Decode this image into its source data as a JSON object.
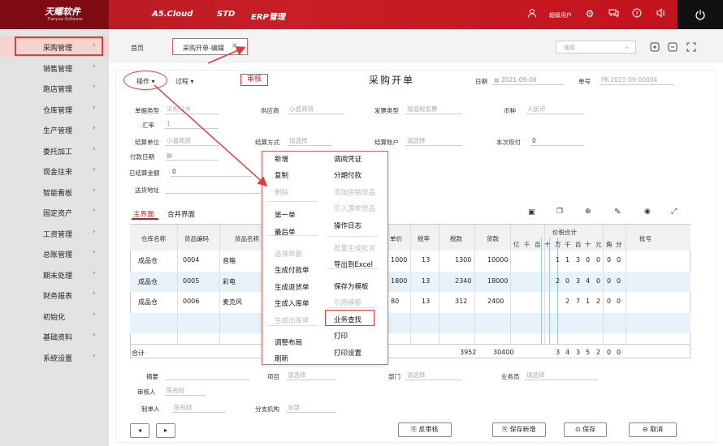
{
  "brand": {
    "name": "天耀软件",
    "sub": "Tianyao Software"
  },
  "top_menu": [
    "A5.Cloud",
    "STD",
    "ERP管理"
  ],
  "top_user": "超级用户",
  "sidebar": [
    {
      "label": "采购管理",
      "active": true
    },
    {
      "label": "销售管理"
    },
    {
      "label": "跑店管理"
    },
    {
      "label": "仓库管理"
    },
    {
      "label": "生产管理"
    },
    {
      "label": "委托加工"
    },
    {
      "label": "现金往来"
    },
    {
      "label": "智能看板"
    },
    {
      "label": "固定资产"
    },
    {
      "label": "工资管理"
    },
    {
      "label": "总账管理"
    },
    {
      "label": "期末处理"
    },
    {
      "label": "财务报表"
    },
    {
      "label": "初始化"
    },
    {
      "label": "基础资料"
    },
    {
      "label": "系统设置"
    }
  ],
  "tabs": {
    "home": "首页",
    "active": "采购开单-编辑"
  },
  "search": {
    "placeholder": "搜索"
  },
  "toolbar": {
    "ops": "操作",
    "process": "过程",
    "audit": "审核",
    "title": "采购开单",
    "date_label": "日期",
    "date_value": "2021-09-06",
    "no_label": "单号",
    "no_value": "PK-2021-09-00004"
  },
  "form": {
    "purchase_type": {
      "label": "单据类型",
      "value": "采购订单"
    },
    "supplier": {
      "label": "供应商",
      "value": "小县商贸"
    },
    "invoice_type": {
      "label": "发票类型",
      "value": "增值税发票"
    },
    "currency": {
      "label": "币种",
      "value": "人民币"
    },
    "rate": {
      "label": "汇率",
      "value": "1"
    },
    "settle_unit": {
      "label": "结算单位",
      "value": "小县商贸"
    },
    "settle_method": {
      "label": "结算方式",
      "value": "请选择"
    },
    "settle_account": {
      "label": "结算账户",
      "value": "请选择"
    },
    "this_pay": {
      "label": "本次现付",
      "value": "0"
    },
    "pay_date": {
      "label": "付款日期",
      "value": ""
    },
    "settled": {
      "label": "已结算金额",
      "value": "0"
    },
    "address": {
      "label": "送货地址",
      "value": ""
    }
  },
  "subtabs": [
    "主界面",
    "合并界面"
  ],
  "table": {
    "headers": [
      "仓库名称",
      "货品编码",
      "货品名称",
      "单价",
      "税率",
      "税款",
      "货款",
      "价税合计",
      "批号"
    ],
    "digit_headers": [
      "亿",
      "千",
      "百",
      "十",
      "万",
      "千",
      "百",
      "十",
      "元",
      "角",
      "分"
    ],
    "rows": [
      {
        "wh": "成品仓",
        "code": "0004",
        "name": "音箱",
        "price": "1000",
        "tax": "13",
        "taxamt": "1300",
        "amount": "10000",
        "digits": "1130000"
      },
      {
        "wh": "成品仓",
        "code": "0005",
        "name": "彩电",
        "price": "1800",
        "tax": "13",
        "taxamt": "2340",
        "amount": "18000",
        "digits": "2034000"
      },
      {
        "wh": "成品仓",
        "code": "0006",
        "name": "麦克风",
        "price": "80",
        "tax": "13",
        "taxamt": "312",
        "amount": "2400",
        "digits": "271200"
      }
    ],
    "total": {
      "label": "合计",
      "taxamt": "3952",
      "amount": "30400",
      "digits": "3435200"
    }
  },
  "footer": {
    "summary": {
      "label": "摘要",
      "value": ""
    },
    "project": {
      "label": "项目",
      "value": "请选择"
    },
    "dept": {
      "label": "部门",
      "value": "请选择"
    },
    "clerk": {
      "label": "业务员",
      "value": "请选择"
    },
    "auditor": {
      "label": "审核人",
      "value": "陈有财"
    },
    "maker": {
      "label": "制单人",
      "value": "陈有财"
    },
    "branch": {
      "label": "分支机构",
      "value": "总部"
    }
  },
  "buttons": {
    "unaudit": "反审核",
    "save_new": "保存新增",
    "save": "保存",
    "cancel": "取消"
  },
  "popup": {
    "left": [
      {
        "label": "新增"
      },
      {
        "label": "复制"
      },
      {
        "label": "删除",
        "disabled": true
      },
      {
        "label": "第一单"
      },
      {
        "label": "最后单"
      },
      {
        "label": "选择单据",
        "disabled": true
      },
      {
        "label": "生成付款单"
      },
      {
        "label": "生成退货单"
      },
      {
        "label": "生成入库单"
      },
      {
        "label": "生成出库单",
        "disabled": true
      },
      {
        "label": "调整布局"
      },
      {
        "label": "刷新"
      }
    ],
    "right": [
      {
        "label": "调阅凭证"
      },
      {
        "label": "分期付款"
      },
      {
        "label": "添加供销货品",
        "disabled": true
      },
      {
        "label": "引入源单货品",
        "disabled": true
      },
      {
        "label": "操作日志"
      },
      {
        "label": "批量生成批次",
        "disabled": true
      },
      {
        "label": "导出到Excel"
      },
      {
        "label": "保存为模板"
      },
      {
        "label": "引用模板",
        "disabled": true
      },
      {
        "label": "业务查找",
        "highlight": true
      },
      {
        "label": "打印"
      },
      {
        "label": "打印设置"
      }
    ]
  },
  "colors": {
    "accent": "#c81e26",
    "highlight": "#e63a3a"
  }
}
